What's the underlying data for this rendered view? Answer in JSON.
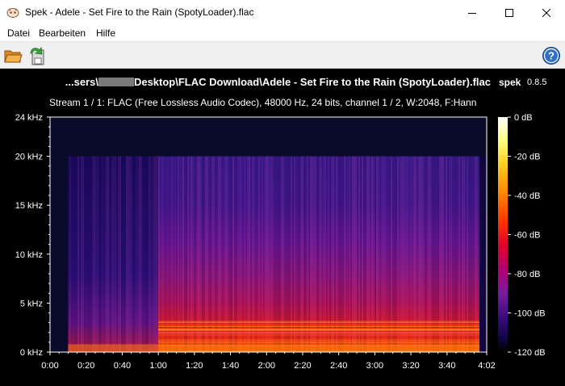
{
  "window": {
    "title": "Spek - Adele - Set Fire to the Rain (SpotyLoader).flac",
    "app_icon": "spek-app-icon",
    "controls": [
      "minimize-icon",
      "maximize-icon",
      "close-icon"
    ]
  },
  "menu": {
    "datei": "Datei",
    "bearbeiten": "Bearbeiten",
    "hilfe": "Hilfe"
  },
  "toolbar": {
    "open_icon": "open-folder-icon",
    "save_icon": "save-icon",
    "help_icon": "help-icon"
  },
  "spectrogram": {
    "title_prefix": "...sers\\",
    "title_suffix": "Desktop\\FLAC Download\\Adele - Set Fire to the Rain (SpotyLoader).flac",
    "app_name": "spek",
    "app_version": "0.8.5",
    "stream_info": "Stream 1 / 1: FLAC (Free Lossless Audio Codec), 48000 Hz, 24 bits, channel 1 / 2, W:2048, F:Hann",
    "colors": {
      "background": "#000000",
      "cutoff_band": "#0a0a2a",
      "scale": [
        "#ffffff",
        "#ffff70",
        "#ffd020",
        "#ff8800",
        "#ff3000",
        "#e00030",
        "#b00070",
        "#7a1aa0",
        "#4a1090",
        "#1e0860",
        "#000000"
      ]
    }
  },
  "chart_data": {
    "type": "heatmap",
    "x_axis": {
      "ticks": [
        "0:00",
        "0:20",
        "0:40",
        "1:00",
        "1:20",
        "1:40",
        "2:00",
        "2:20",
        "2:40",
        "3:00",
        "3:20",
        "3:40",
        "4:02"
      ],
      "tick_seconds": [
        0,
        20,
        40,
        60,
        80,
        100,
        120,
        140,
        160,
        180,
        200,
        220,
        242
      ],
      "range_seconds": [
        0,
        242
      ]
    },
    "y_axis": {
      "ticks": [
        "0 kHz",
        "5 kHz",
        "10 kHz",
        "15 kHz",
        "20 kHz",
        "24 kHz"
      ],
      "tick_values_khz": [
        0,
        5,
        10,
        15,
        20,
        24
      ],
      "range_khz": [
        0,
        24
      ]
    },
    "color_scale": {
      "ticks": [
        "0 dB",
        "-20 dB",
        "-40 dB",
        "-60 dB",
        "-80 dB",
        "-100 dB",
        "-120 dB"
      ],
      "tick_values_db": [
        0,
        -20,
        -40,
        -60,
        -80,
        -100,
        -120
      ],
      "range_db": [
        -120,
        0
      ]
    },
    "lowpass_cutoff_khz": 20,
    "audio_start_seconds": 10
  }
}
